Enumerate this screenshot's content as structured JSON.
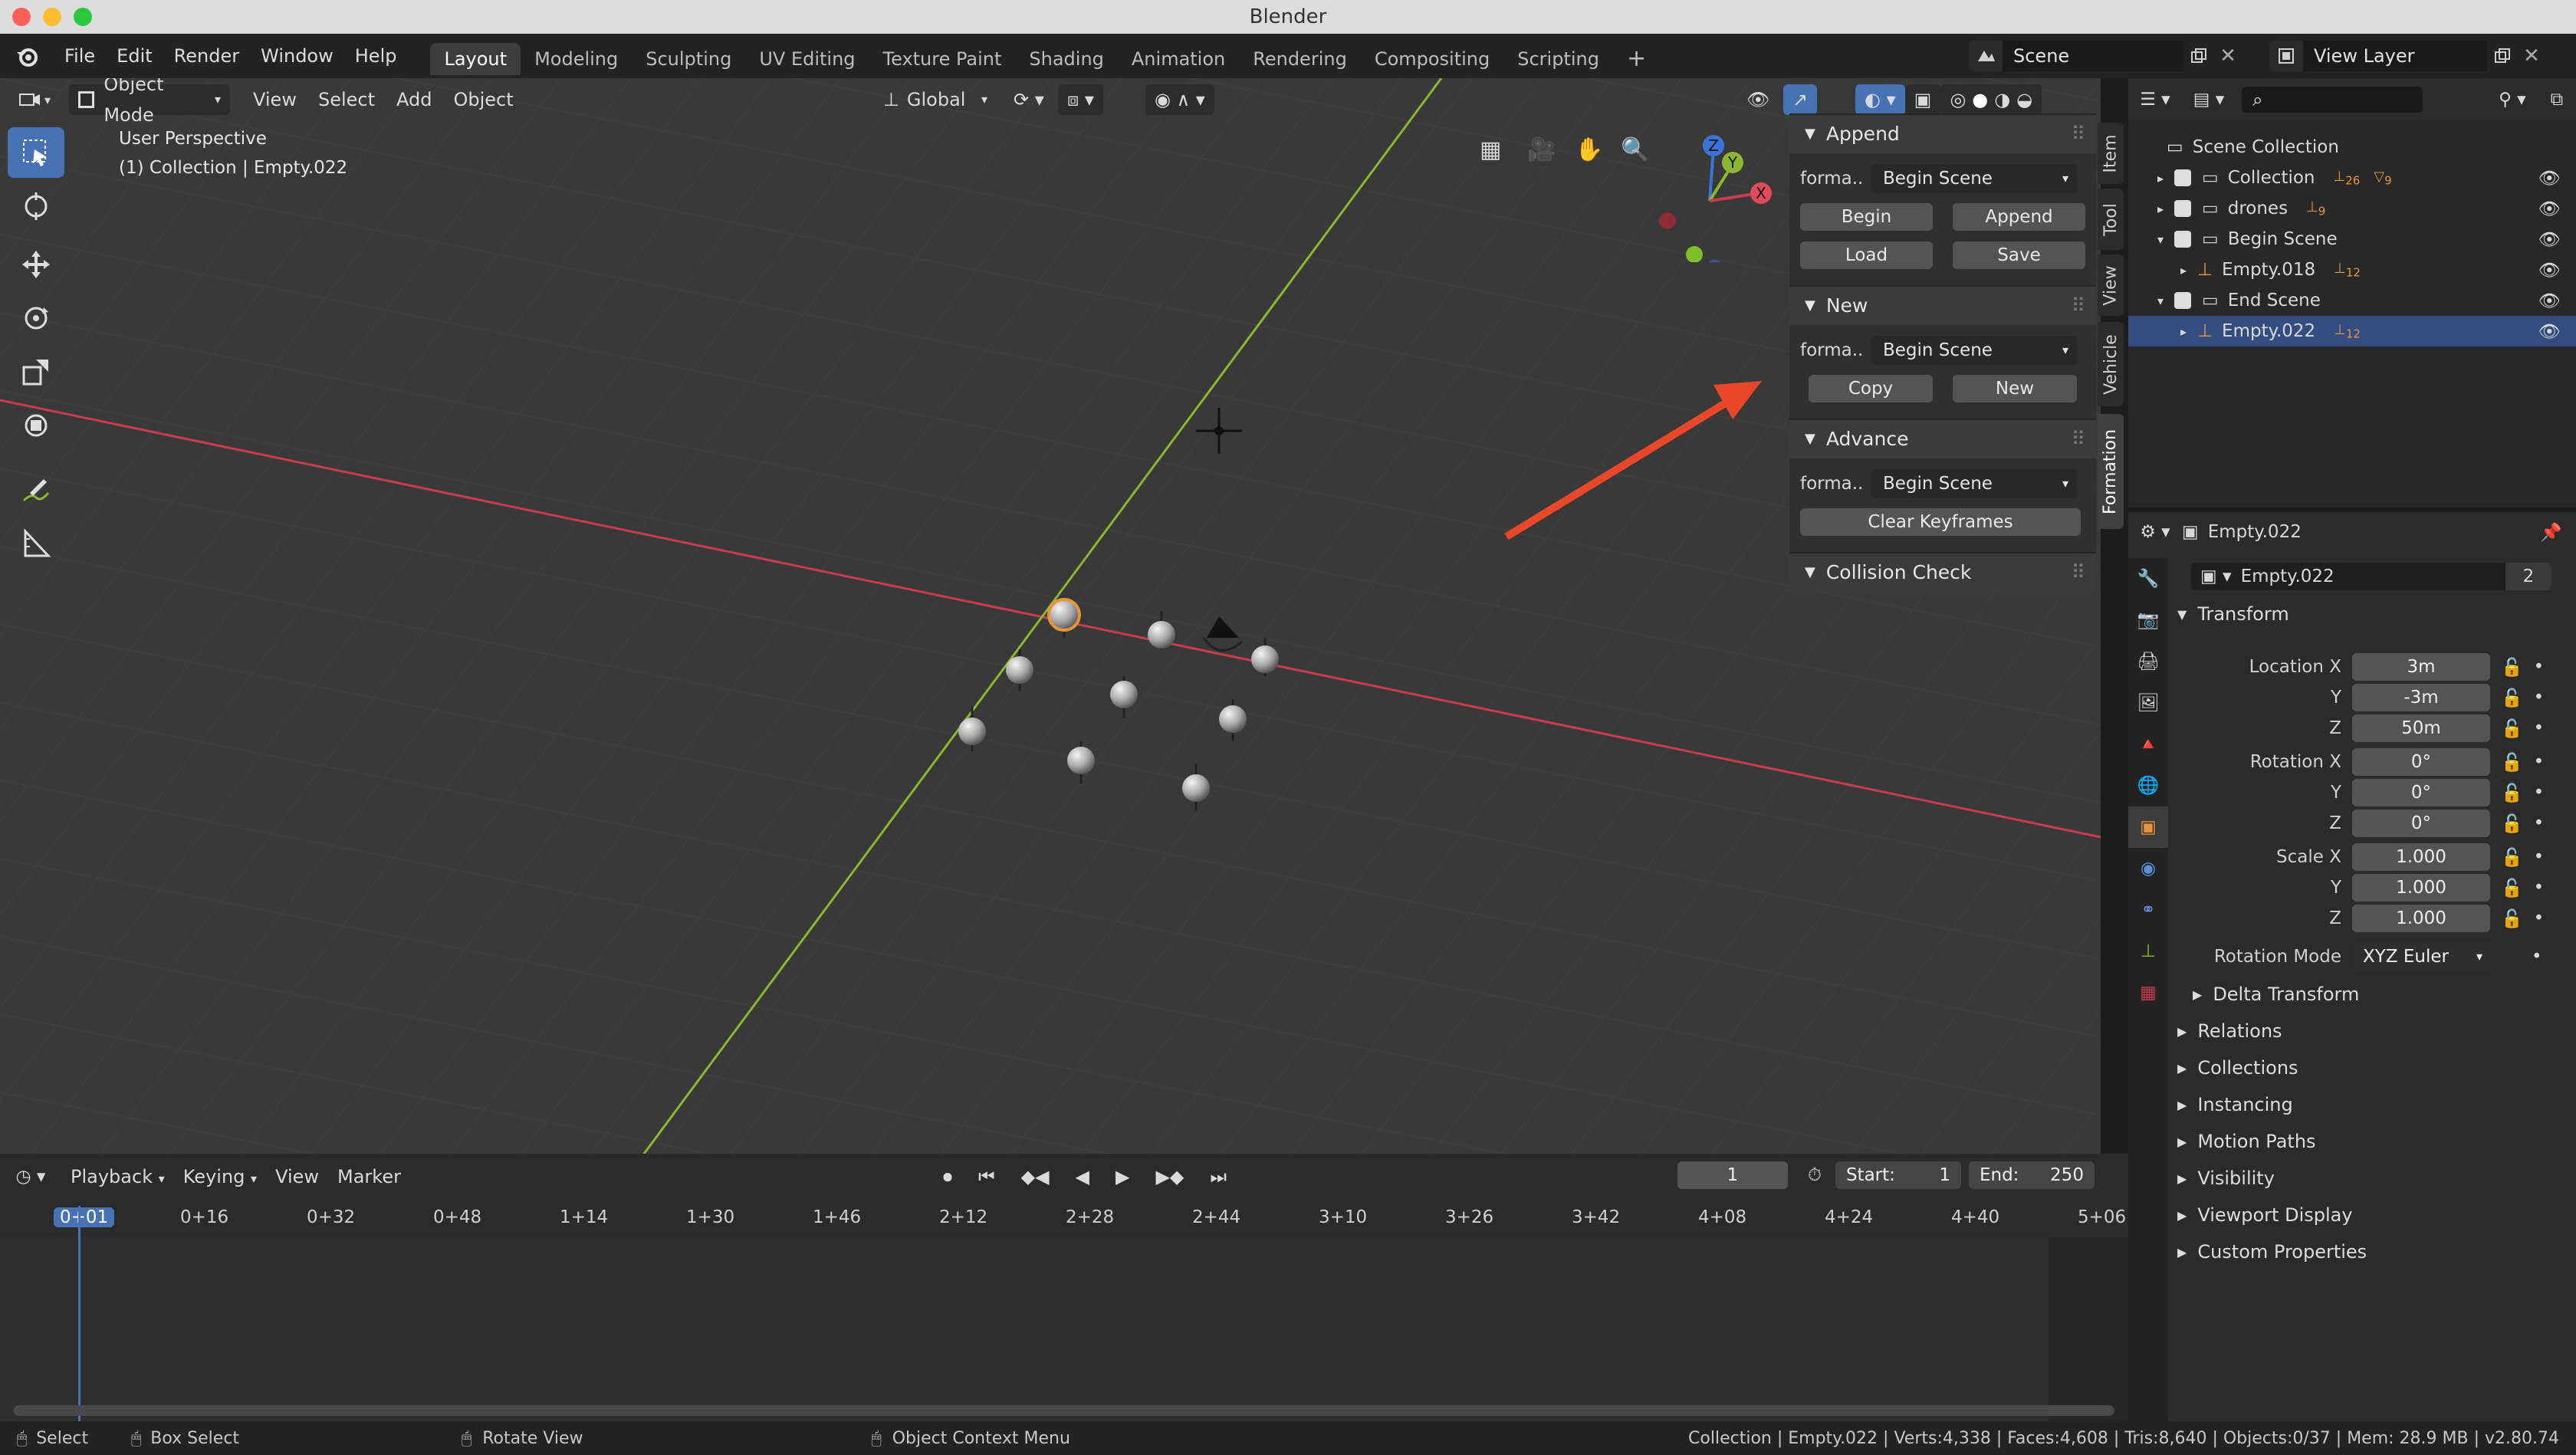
{
  "window": {
    "title": "Blender"
  },
  "menu": {
    "items": [
      "File",
      "Edit",
      "Render",
      "Window",
      "Help"
    ]
  },
  "workspaces": {
    "tabs": [
      "Layout",
      "Modeling",
      "Sculpting",
      "UV Editing",
      "Texture Paint",
      "Shading",
      "Animation",
      "Rendering",
      "Compositing",
      "Scripting"
    ],
    "active": "Layout",
    "add": "+"
  },
  "scene": {
    "name": "Scene"
  },
  "view_layer": {
    "name": "View Layer"
  },
  "viewport_header": {
    "mode": "Object Mode",
    "menus": [
      "View",
      "Select",
      "Add",
      "Object"
    ],
    "transform_orientation": "Global"
  },
  "viewport": {
    "perspective": "User Perspective",
    "context": "(1) Collection | Empty.022",
    "gizmo_axes": [
      "Z",
      "Y",
      "X"
    ]
  },
  "npanel": {
    "sections": [
      {
        "title": "Append",
        "format_label": "forma..",
        "format_value": "Begin Scene",
        "buttons": [
          [
            "Begin",
            "Append"
          ],
          [
            "Load",
            "Save"
          ]
        ]
      },
      {
        "title": "New",
        "format_label": "forma..",
        "format_value": "Begin Scene",
        "buttons": [
          [
            "Copy",
            "New"
          ]
        ]
      },
      {
        "title": "Advance",
        "format_label": "forma..",
        "format_value": "Begin Scene",
        "buttons": [
          [
            "Clear Keyframes"
          ]
        ]
      },
      {
        "title": "Collision Check"
      }
    ],
    "tabs": [
      "Item",
      "Tool",
      "View",
      "Vehicle",
      "Formation"
    ],
    "active_tab": "Formation"
  },
  "outliner": {
    "root": "Scene Collection",
    "rows": [
      {
        "name": "Collection",
        "badges": [
          "26",
          "9"
        ]
      },
      {
        "name": "drones",
        "badges": [
          "9"
        ]
      },
      {
        "name": "Begin Scene",
        "badges": []
      },
      {
        "name": "Empty.018",
        "badges": [
          "12"
        ]
      },
      {
        "name": "End Scene",
        "badges": []
      },
      {
        "name": "Empty.022",
        "badges": [
          "12"
        ]
      }
    ]
  },
  "properties": {
    "object_name": "Empty.022",
    "datablock_name": "Empty.022",
    "users": "2",
    "transform_title": "Transform",
    "location": {
      "label": "Location X",
      "x": "3m",
      "y": "-3m",
      "z": "50m"
    },
    "rotation": {
      "label": "Rotation X",
      "x": "0°",
      "y": "0°",
      "z": "0°"
    },
    "scale": {
      "label": "Scale X",
      "x": "1.000",
      "y": "1.000",
      "z": "1.000"
    },
    "axis_labels": {
      "y": "Y",
      "z": "Z"
    },
    "rotation_mode": {
      "label": "Rotation Mode",
      "value": "XYZ Euler"
    },
    "delta_transform": "Delta Transform",
    "panels": [
      "Relations",
      "Collections",
      "Instancing",
      "Motion Paths",
      "Visibility",
      "Viewport Display",
      "Custom Properties"
    ]
  },
  "timeline": {
    "menus": [
      "Playback",
      "Keying",
      "View",
      "Marker"
    ],
    "current_frame": "1",
    "start_label": "Start:",
    "start": "1",
    "end_label": "End:",
    "end": "250",
    "ticks": [
      "0+01",
      "0+16",
      "0+32",
      "0+48",
      "1+14",
      "1+30",
      "1+46",
      "2+12",
      "2+28",
      "2+44",
      "3+10",
      "3+26",
      "3+42",
      "4+08",
      "4+24",
      "4+40",
      "5+06"
    ]
  },
  "statusbar": {
    "select": "Select",
    "box_select": "Box Select",
    "rotate_view": "Rotate View",
    "context_menu": "Object Context Menu",
    "stats": "Collection | Empty.022 | Verts:4,338 | Faces:4,608 | Tris:8,640 | Objects:0/37 | Mem: 28.9 MB | v2.80.74"
  },
  "colors": {
    "accent": "#4772b3",
    "x_axis": "#c83c4b",
    "y_axis": "#8ab72f",
    "z_axis": "#3a74d6",
    "arrow": "#e8472a",
    "object_orange": "#e8953a"
  }
}
